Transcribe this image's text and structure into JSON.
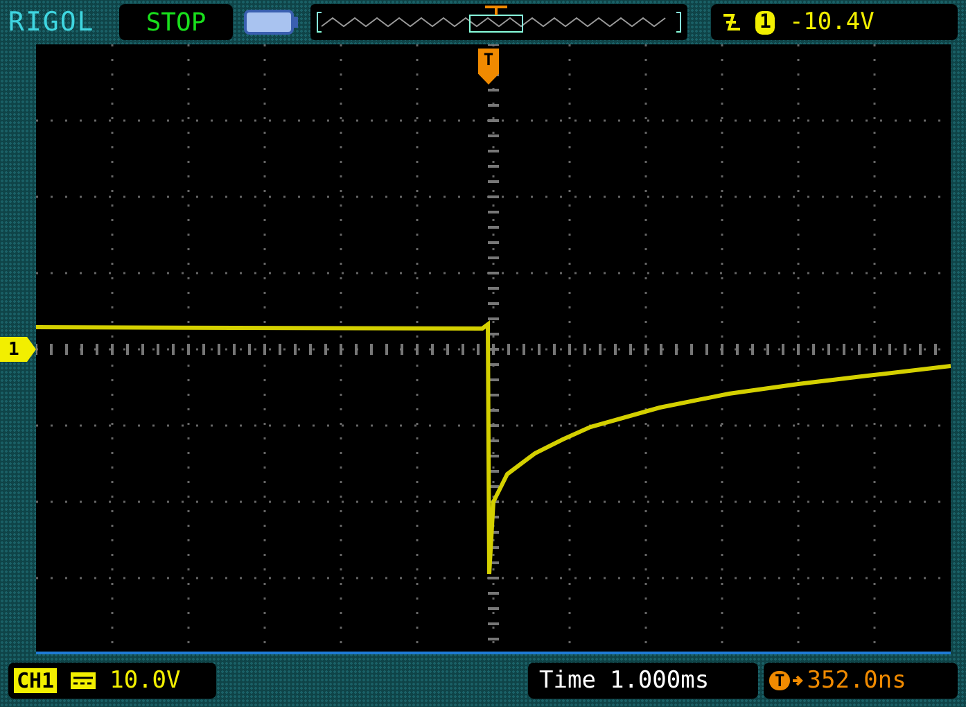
{
  "top_bar": {
    "brand": "RIGOL",
    "run_state": "STOP",
    "trigger": {
      "source": "1",
      "level": "-10.4V"
    }
  },
  "screen": {
    "trigger_marker": "T",
    "channel_marker": "1"
  },
  "bottom_bar": {
    "channel": {
      "label": "CH1",
      "scale": "10.0V"
    },
    "timebase": {
      "label": "Time",
      "value": "1.000ms"
    },
    "trigger_offset": {
      "marker": "T",
      "value": "352.0ns"
    }
  }
}
